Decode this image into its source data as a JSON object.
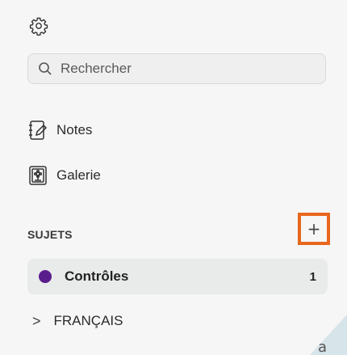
{
  "toolbar": {
    "settings_icon": "gear-icon"
  },
  "search": {
    "placeholder": "Rechercher",
    "icon": "search-icon"
  },
  "nav": {
    "items": [
      {
        "label": "Notes",
        "icon": "notes-icon"
      },
      {
        "label": "Galerie",
        "icon": "gallery-icon"
      }
    ]
  },
  "sections": {
    "title": "SUJETS",
    "add_label": "+",
    "selected": {
      "label": "Contrôles",
      "count": "1",
      "color": "#5a1d8c"
    },
    "folder": {
      "label": "FRANÇAIS",
      "chevron": ">"
    }
  },
  "colors": {
    "highlight": "#e8671d",
    "sidebar_bg": "#f6f6f6"
  }
}
